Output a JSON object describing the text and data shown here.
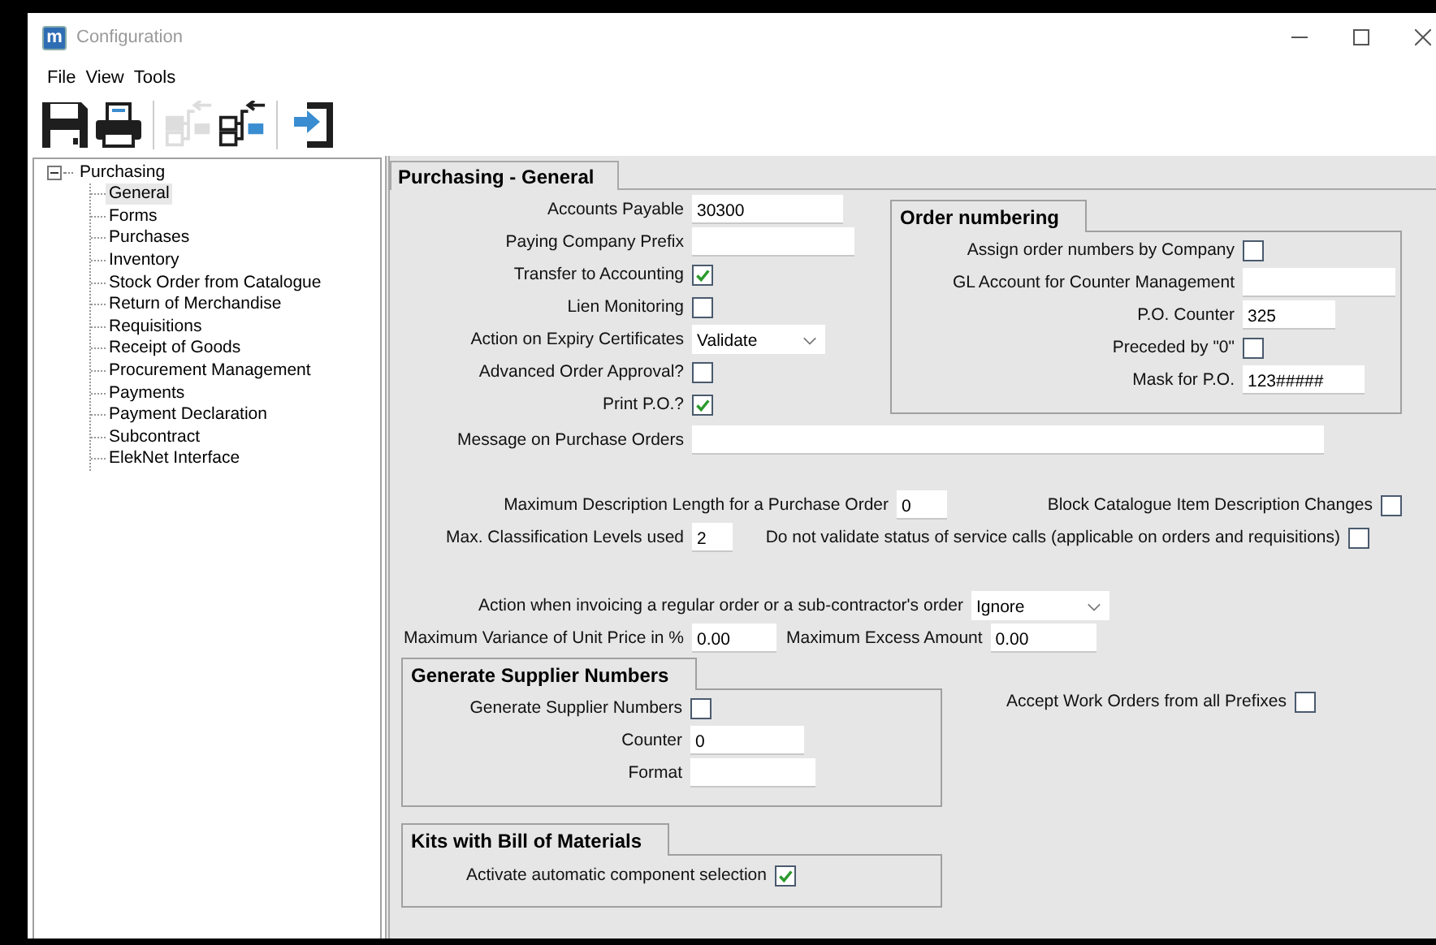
{
  "window": {
    "logo": "m",
    "title": "Configuration"
  },
  "menu": [
    "File",
    "View",
    "Tools"
  ],
  "toolbar": [
    {
      "kind": "save",
      "disabled": false
    },
    {
      "kind": "print",
      "disabled": false
    },
    {
      "kind": "send",
      "disabled": true
    },
    {
      "kind": "receive",
      "disabled": false
    },
    {
      "kind": "exit",
      "disabled": false
    }
  ],
  "tree": {
    "label": "Purchasing",
    "expanded": true,
    "children": [
      {
        "label": "General",
        "selected": true
      },
      {
        "label": "Forms",
        "selected": false
      },
      {
        "label": "Purchases",
        "selected": false
      },
      {
        "label": "Inventory",
        "selected": false
      },
      {
        "label": "Stock Order from Catalogue",
        "selected": false
      },
      {
        "label": "Return of Merchandise",
        "selected": false
      },
      {
        "label": "Requisitions",
        "selected": false
      },
      {
        "label": "Receipt of Goods",
        "selected": false
      },
      {
        "label": "Procurement Management",
        "selected": false
      },
      {
        "label": "Payments",
        "selected": false
      },
      {
        "label": "Payment Declaration",
        "selected": false
      },
      {
        "label": "Subcontract",
        "selected": false
      },
      {
        "label": "ElekNet Interface",
        "selected": false
      }
    ]
  },
  "tab": {
    "label": "Purchasing - General"
  },
  "general": [
    {
      "kind": "text",
      "label": "Accounts Payable",
      "value": "30300"
    },
    {
      "kind": "text",
      "label": "Paying Company Prefix"
    },
    {
      "kind": "checkbox",
      "label": "Transfer to Accounting",
      "checked": true
    },
    {
      "kind": "checkbox",
      "label": "Lien Monitoring",
      "checked": false
    },
    {
      "kind": "dropdown",
      "label": "Action on Expiry Certificates",
      "value": "Validate"
    },
    {
      "kind": "checkbox",
      "label": "Advanced Order Approval?",
      "checked": false
    },
    {
      "kind": "checkbox",
      "label": "Print P.O.?",
      "checked": true
    },
    {
      "kind": "text",
      "label": "Message on Purchase Orders"
    }
  ],
  "order_numbering": {
    "title": "Order numbering",
    "fields": [
      {
        "kind": "checkbox",
        "label": "Assign order numbers by Company",
        "checked": false
      },
      {
        "kind": "text",
        "label": "GL Account for Counter Management"
      },
      {
        "kind": "text",
        "label": "P.O. Counter",
        "value": "325"
      },
      {
        "kind": "checkbox",
        "label": "Preceded by \"0\"",
        "checked": false
      },
      {
        "kind": "text",
        "label": "Mask for P.O.",
        "value": "123#####"
      }
    ]
  },
  "limits": [
    {
      "kind": "text",
      "label": "Maximum Description Length for a Purchase Order",
      "value": "0"
    },
    {
      "kind": "checkbox",
      "label": "Block Catalogue Item Description Changes",
      "checked": false
    },
    {
      "kind": "text",
      "label": "Max. Classification Levels used",
      "value": "2"
    },
    {
      "kind": "checkbox",
      "label": "Do not validate status of service calls (applicable on orders and requisitions)",
      "checked": false
    }
  ],
  "invoicing": [
    {
      "kind": "dropdown",
      "label": "Action when invoicing a regular order or a sub-contractor's order",
      "value": "Ignore"
    },
    {
      "kind": "text",
      "label": "Maximum Variance of Unit Price in %",
      "value": "0.00"
    },
    {
      "kind": "text",
      "label": "Maximum Excess Amount",
      "value": "0.00"
    }
  ],
  "supplier_numbers": {
    "title": "Generate Supplier Numbers",
    "fields": [
      {
        "kind": "checkbox",
        "label": "Generate Supplier Numbers",
        "checked": false
      },
      {
        "kind": "text",
        "label": "Counter",
        "value": "0"
      },
      {
        "kind": "text",
        "label": "Format"
      }
    ]
  },
  "work_orders": {
    "kind": "checkbox",
    "label": "Accept Work Orders from all Prefixes",
    "checked": false
  },
  "kits": {
    "title": "Kits with Bill of Materials",
    "fields": [
      {
        "kind": "checkbox",
        "label": "Activate automatic component selection",
        "checked": true
      }
    ]
  }
}
